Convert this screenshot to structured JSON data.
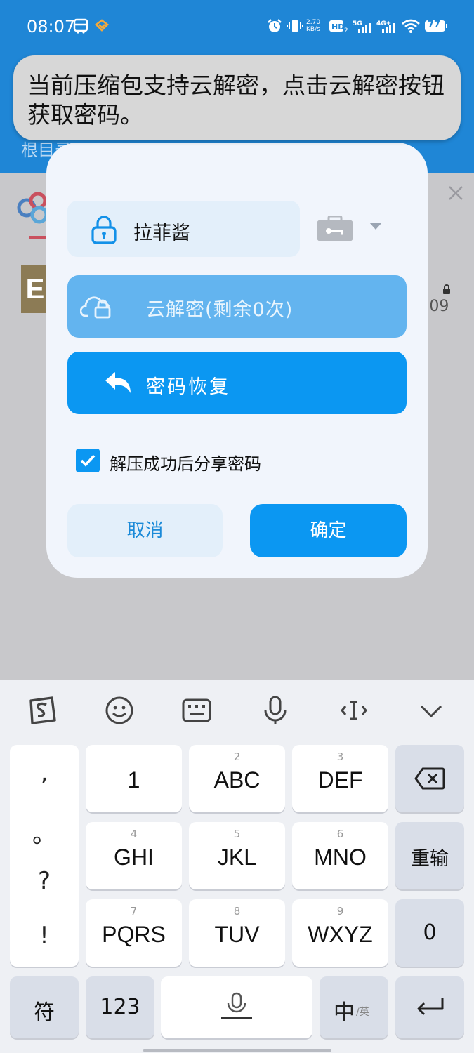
{
  "status_bar": {
    "time": "08:07",
    "network_speed": "2.70 KB/s",
    "battery": "77"
  },
  "header": {
    "breadcrumb": "根目录"
  },
  "toast": {
    "message": "当前压缩包支持云解密，点击云解密按钮获取密码。"
  },
  "background_list": {
    "file_icon_letter": "E",
    "file_time": ":09"
  },
  "dialog": {
    "password_source": "拉菲酱",
    "cloud_decrypt_label": "云解密(剩余0次)",
    "password_recovery_label": "密码恢复",
    "share_password_checked": true,
    "share_password_label": "解压成功后分享密码",
    "cancel_label": "取消",
    "confirm_label": "确定"
  },
  "keyboard": {
    "punctuation": [
      ",",
      "。",
      "?",
      "!"
    ],
    "rows": [
      [
        {
          "num": "",
          "main": "1"
        },
        {
          "num": "2",
          "main": "ABC"
        },
        {
          "num": "3",
          "main": "DEF"
        }
      ],
      [
        {
          "num": "4",
          "main": "GHI"
        },
        {
          "num": "5",
          "main": "JKL"
        },
        {
          "num": "6",
          "main": "MNO"
        }
      ],
      [
        {
          "num": "7",
          "main": "PQRS"
        },
        {
          "num": "8",
          "main": "TUV"
        },
        {
          "num": "9",
          "main": "WXYZ"
        }
      ]
    ],
    "reenter_label": "重输",
    "zero_label": "0",
    "symbols_label": "符",
    "numbers_label": "123",
    "lang_main": "中",
    "lang_sub": "/英"
  },
  "colors": {
    "primary": "#0b97f2",
    "header": "#1f86d6",
    "cloud_button": "#63b4ef"
  }
}
